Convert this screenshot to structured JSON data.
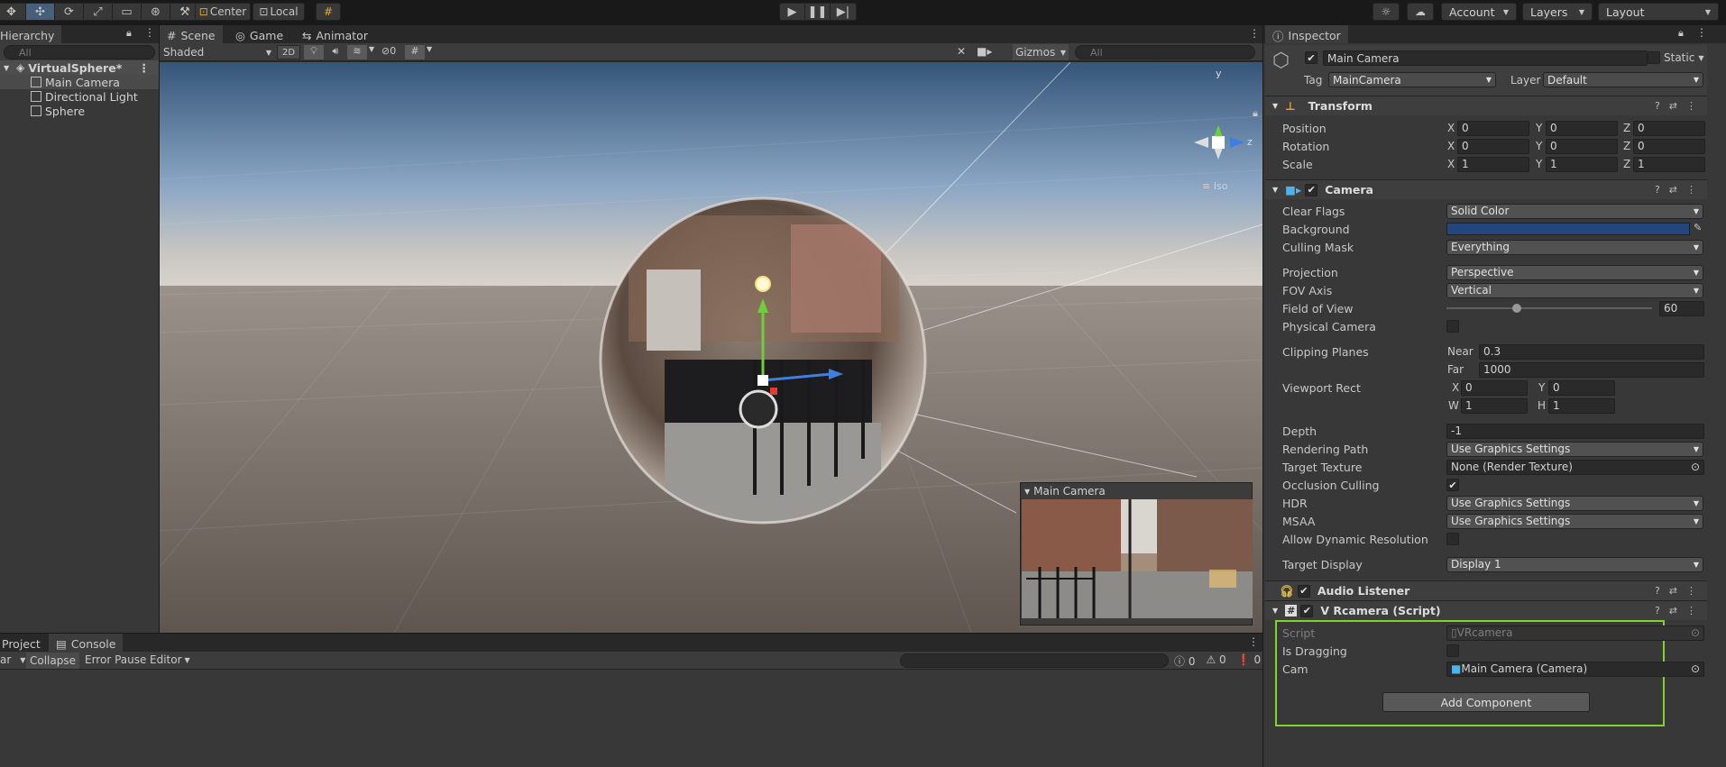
{
  "toolbar": {
    "tools": [
      "✥",
      "✣",
      "⟳",
      "⤢",
      "▭",
      "⊛",
      "⚒"
    ],
    "pivot_label": "Center",
    "space_label": "Local",
    "account_label": "Account",
    "layers_label": "Layers",
    "layout_label": "Layout"
  },
  "hierarchy": {
    "tab_label": "Hierarchy",
    "search_placeholder": "All",
    "scene_name": "VirtualSphere*",
    "items": [
      {
        "label": "Main Camera"
      },
      {
        "label": "Directional Light"
      },
      {
        "label": "Sphere"
      }
    ]
  },
  "scene_view": {
    "tabs": [
      {
        "label": "Scene"
      },
      {
        "label": "Game"
      },
      {
        "label": "Animator"
      }
    ],
    "shading_mode": "Shaded",
    "mode_2d": "2D",
    "hidden_count": "0",
    "gizmos_label": "Gizmos",
    "search_placeholder": "All",
    "axis_y": "y",
    "axis_z": "z",
    "projection_label": "Iso",
    "preview_title": "Main Camera",
    "sky_color": "#6e8fb4",
    "ground_color": "#7d756e"
  },
  "console": {
    "tabs": [
      {
        "label": "Project"
      },
      {
        "label": "Console"
      }
    ],
    "clear_label": "ar",
    "collapse_label": "Collapse",
    "error_pause_label": "Error Pause",
    "editor_label": "Editor",
    "log_count": "0",
    "warn_count": "0",
    "error_count": "0"
  },
  "inspector": {
    "tab_label": "Inspector",
    "object_name": "Main Camera",
    "static_label": "Static",
    "tag_label": "Tag",
    "tag_value": "MainCamera",
    "layer_label": "Layer",
    "layer_value": "Default",
    "transform": {
      "title": "Transform",
      "rows": [
        {
          "label": "Position",
          "x": "0",
          "y": "0",
          "z": "0"
        },
        {
          "label": "Rotation",
          "x": "0",
          "y": "0",
          "z": "0"
        },
        {
          "label": "Scale",
          "x": "1",
          "y": "1",
          "z": "1"
        }
      ]
    },
    "camera": {
      "title": "Camera",
      "clear_flags_label": "Clear Flags",
      "clear_flags": "Solid Color",
      "background_label": "Background",
      "background_color": "#23477d",
      "culling_mask_label": "Culling Mask",
      "culling_mask": "Everything",
      "projection_label": "Projection",
      "projection": "Perspective",
      "fov_axis_label": "FOV Axis",
      "fov_axis": "Vertical",
      "fov_label": "Field of View",
      "fov": "60",
      "fov_slider_fraction": 0.34,
      "physical_label": "Physical Camera",
      "clipping_label": "Clipping Planes",
      "near_label": "Near",
      "near": "0.3",
      "far_label": "Far",
      "far": "1000",
      "viewport_label": "Viewport Rect",
      "vx": "0",
      "vy": "0",
      "vw": "1",
      "vh": "1",
      "depth_label": "Depth",
      "depth": "-1",
      "rendering_path_label": "Rendering Path",
      "rendering_path": "Use Graphics Settings",
      "target_texture_label": "Target Texture",
      "target_texture": "None (Render Texture)",
      "occlusion_label": "Occlusion Culling",
      "hdr_label": "HDR",
      "hdr": "Use Graphics Settings",
      "msaa_label": "MSAA",
      "msaa": "Use Graphics Settings",
      "dynres_label": "Allow Dynamic Resolution",
      "target_display_label": "Target Display",
      "target_display": "Display 1"
    },
    "audio_listener": {
      "title": "Audio Listener"
    },
    "vrcamera": {
      "title": "V Rcamera (Script)",
      "script_label": "Script",
      "script_value": "VRcamera",
      "dragging_label": "Is Dragging",
      "cam_label": "Cam",
      "cam_value": "Main Camera (Camera)"
    },
    "add_component_label": "Add Component"
  },
  "colors": {
    "highlight": "#7fd32a",
    "accent": "#46607c"
  }
}
